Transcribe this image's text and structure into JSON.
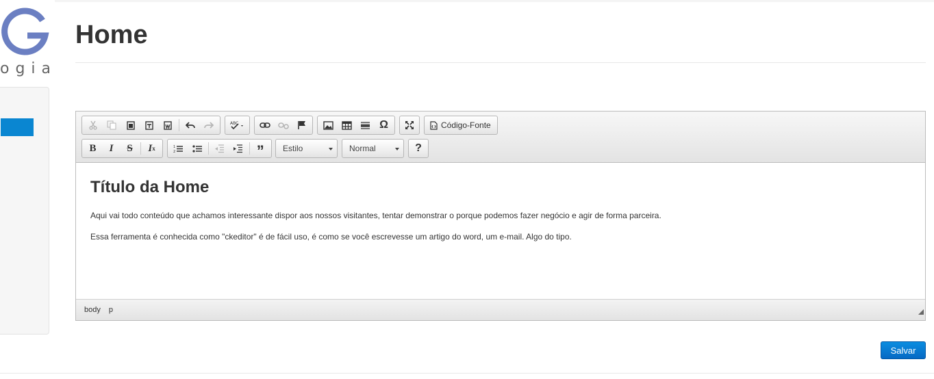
{
  "logo": {
    "letter": "G",
    "subtext": "ogia"
  },
  "page": {
    "title": "Home"
  },
  "editor": {
    "toolbar": {
      "source_label": "Código-Fonte",
      "style_combo": "Estilo",
      "format_combo": "Normal",
      "help_label": "?"
    },
    "content": {
      "heading": "Título da Home",
      "paragraph1": "Aqui vai todo conteúdo que achamos interessante dispor aos nossos visitantes, tentar demonstrar o porque podemos fazer negócio e agir de forma parceira.",
      "paragraph2": "Essa ferramenta é conhecida como \"ckeditor\" é de fácil uso, é como se você escrevesse um artigo do word, um e-mail. Algo do tipo."
    },
    "path": [
      "body",
      "p"
    ]
  },
  "actions": {
    "save_label": "Salvar"
  },
  "colors": {
    "accent": "#0a86d1",
    "button": "#0669c4"
  }
}
